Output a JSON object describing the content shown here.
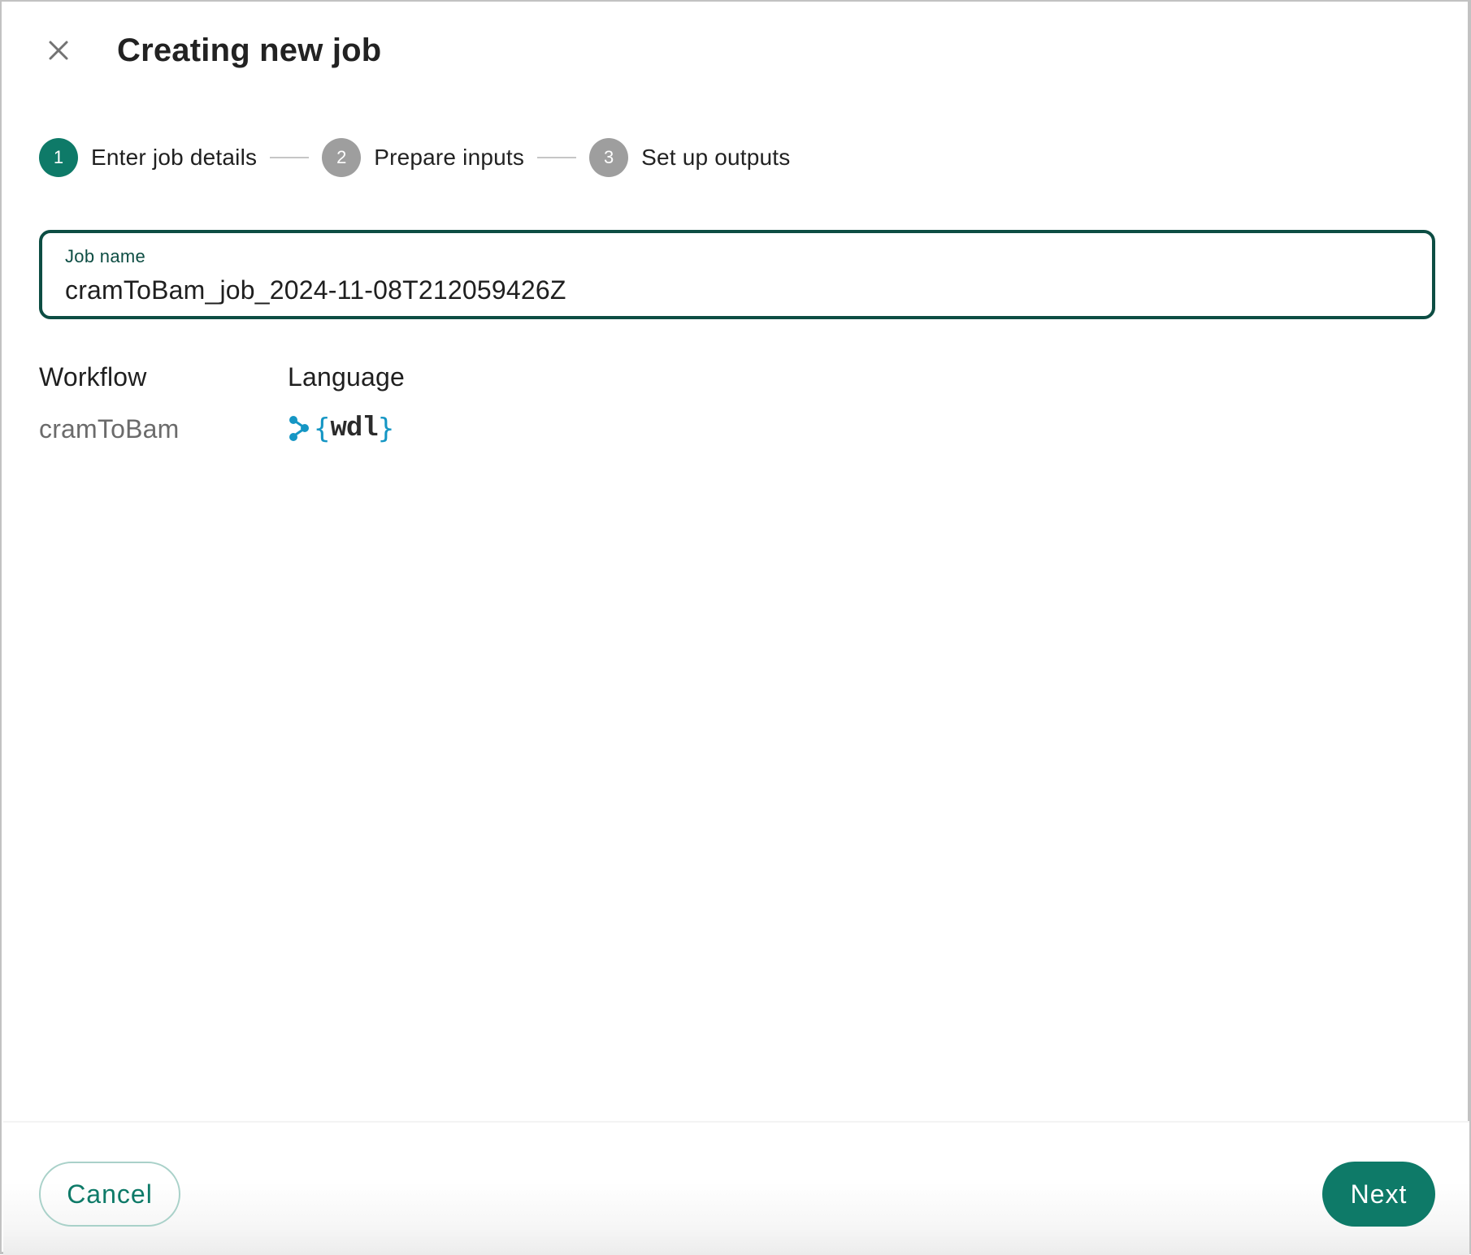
{
  "dialog": {
    "title": "Creating new job",
    "close_icon": "close-icon"
  },
  "stepper": {
    "steps": [
      {
        "number": "1",
        "label": "Enter job details",
        "state": "active"
      },
      {
        "number": "2",
        "label": "Prepare inputs",
        "state": "inactive"
      },
      {
        "number": "3",
        "label": "Set up outputs",
        "state": "inactive"
      }
    ]
  },
  "job_name": {
    "label": "Job name",
    "value": "cramToBam_job_2024-11-08T212059426Z",
    "placeholder": ""
  },
  "details": {
    "workflow_heading": "Workflow",
    "workflow_value": "cramToBam",
    "language_heading": "Language",
    "language_logo": {
      "icon": "wdl-logo-icon",
      "open_brace": "{",
      "text": "wdl",
      "close_brace": "}"
    }
  },
  "footer": {
    "cancel_label": "Cancel",
    "next_label": "Next"
  },
  "colors": {
    "accent": "#0e7a68",
    "field_border": "#0d4d43",
    "inactive_step": "#9e9e9e",
    "wdl_blue": "#1596c4"
  }
}
